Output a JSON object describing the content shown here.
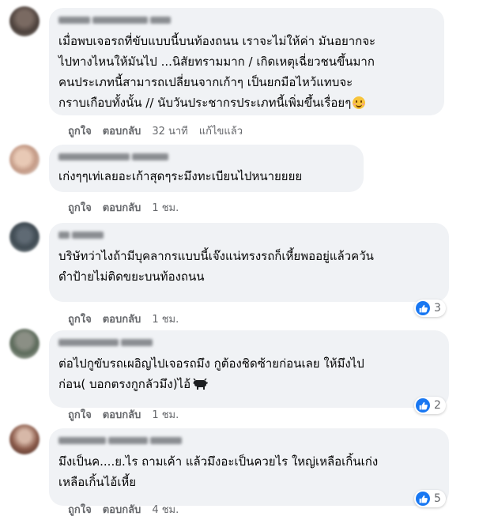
{
  "colors": {
    "bubble": "#f0f2f5",
    "meta": "#65676b",
    "like": "#1877f2"
  },
  "comments": [
    {
      "text": "เมื่อพบเจอรถที่ขับแบบนี้บนท้องถนน เราจะไม่ให้ค่า มันอยากจะ\nไปทางไหนให้มันไป ...นิสัยทรามมาก / เกิดเหตุเฉี่ยวชนขึ้นมาก\nคนประเภทนี้สามารถเปลี่ยนจากเก้าๆ เป็นยกมือไหว้แทบจะ\nกราบเกือบทั้งนั้น // นับวันประชากรประเภทนี้เพิ่มขึ้นเรื่อยๆ",
      "emoji": "smiling-face-icon",
      "like_label": "ถูกใจ",
      "reply_label": "ตอบกลับ",
      "time": "32 นาที",
      "edited": "แก้ไขแล้ว"
    },
    {
      "text": "เก่งๆๆเท่เลยอะเก้าสุดๆระมึงทะเบียนไปหนายยยย",
      "like_label": "ถูกใจ",
      "reply_label": "ตอบกลับ",
      "time": "1 ชม."
    },
    {
      "text": "บริษัทว่าไงถ้ามีบุคลากรแบบนี้เจ๊งแน่ทรงรถก็เหี้ยพออยู่แล้วควัน\nดำป้ายไม่ติดขยะบนท้องถนน",
      "like_label": "ถูกใจ",
      "reply_label": "ตอบกลับ",
      "time": "1 ชม.",
      "reactions": "3"
    },
    {
      "text": "ต่อไปกูขับรถเผอิญไปเจอรถมึง กูต้องชิดซ้ายก่อนเลย ให้มึงไป\nก่อน( บอกตรงกูกลัวมึง)ไอ้",
      "emoji": "ox-icon",
      "like_label": "ถูกใจ",
      "reply_label": "ตอบกลับ",
      "time": "1 ชม.",
      "reactions": "2"
    },
    {
      "text": "มึงเป็นค....ย.ไร ถามเค้า แล้วมึงอะเป็นควยไร ใหญ่เหลือเกิ้นเก่ง\nเหลือเกิ้นไอ้เหี้ย",
      "like_label": "ถูกใจ",
      "reply_label": "ตอบกลับ",
      "time": "4 ชม.",
      "reactions": "5"
    }
  ]
}
